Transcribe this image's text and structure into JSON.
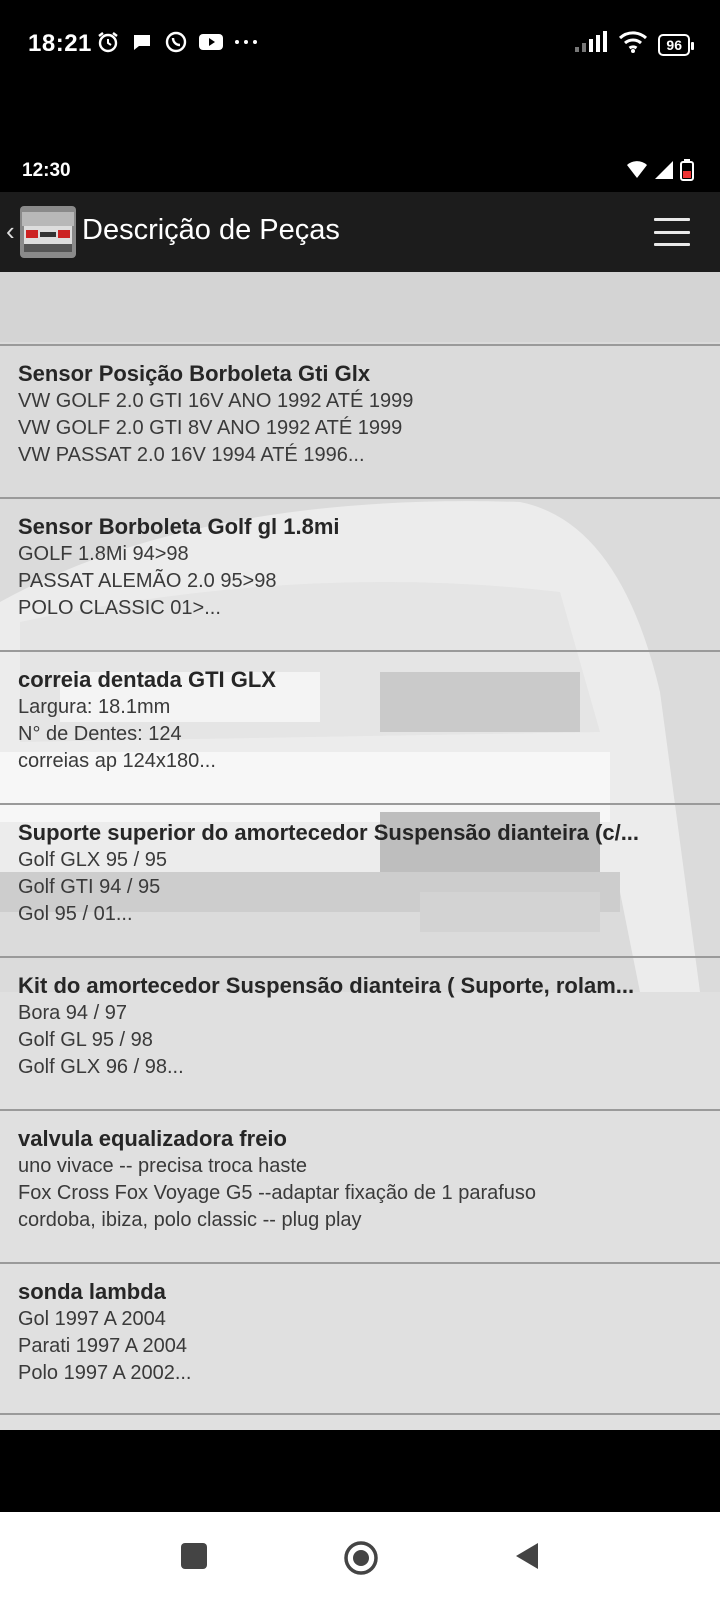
{
  "outer_status": {
    "time": "18:21",
    "notification_icons": [
      "alarm-icon",
      "chat-bubble-icon",
      "whatsapp-icon",
      "youtube-icon",
      "more-dots-icon"
    ],
    "battery": "96"
  },
  "inner_status": {
    "time": "12:30"
  },
  "app_bar": {
    "title": "Descrição de Peças"
  },
  "items": [
    {
      "title": "Sensor Posição Borboleta Gti Glx",
      "lines": [
        "VW GOLF 2.0 GTI 16V ANO 1992 ATÉ 1999",
        "VW GOLF 2.0 GTI 8V ANO 1992 ATÉ 1999",
        "VW PASSAT 2.0 16V 1994 ATÉ 1996..."
      ]
    },
    {
      "title": "Sensor Borboleta Golf gl 1.8mi",
      "lines": [
        "GOLF 1.8Mi 94>98",
        "PASSAT ALEMÃO 2.0 95>98",
        "POLO CLASSIC 01>..."
      ]
    },
    {
      "title": "correia dentada GTI GLX",
      "lines": [
        "Largura: 18.1mm",
        "N° de Dentes: 124",
        "correias ap 124x180..."
      ]
    },
    {
      "title": "Suporte superior do amortecedor Suspensão dianteira (c/...",
      "lines": [
        "Golf GLX 95 / 95",
        "Golf GTI 94 / 95",
        "Gol 95 / 01..."
      ]
    },
    {
      "title": "Kit do amortecedor Suspensão dianteira ( Suporte, rolam...",
      "lines": [
        "Bora 94 / 97",
        "Golf GL 95 / 98",
        "Golf GLX 96 / 98..."
      ]
    },
    {
      "title": "valvula equalizadora freio",
      "lines": [
        "uno vivace -- precisa troca haste",
        "Fox Cross Fox Voyage G5 --adaptar fixação de 1 parafuso",
        "cordoba, ibiza, polo classic -- plug play"
      ]
    },
    {
      "title": "sonda lambda",
      "lines": [
        "Gol 1997 A 2004",
        "Parati 1997 A 2004",
        "Polo 1997 A 2002..."
      ]
    }
  ],
  "colors": {
    "app_bar": "#1c1c1c",
    "content_bg": "#d3d3d3",
    "divider": "#9a9a9a",
    "title_text": "#262626",
    "body_text": "#3a3a3a"
  }
}
